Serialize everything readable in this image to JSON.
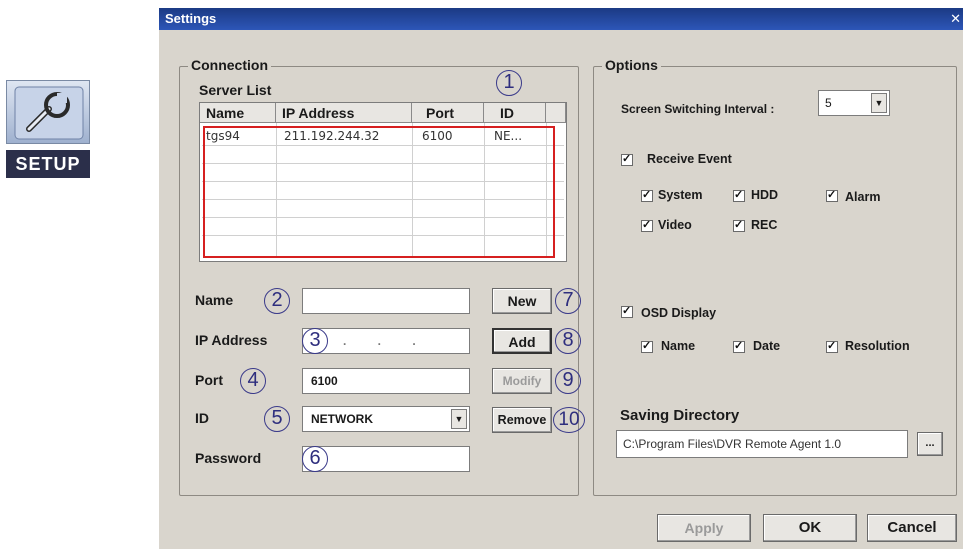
{
  "setup_tile": {
    "label": "SETUP"
  },
  "window": {
    "title": "Settings"
  },
  "connection": {
    "title": "Connection",
    "server_list_label": "Server List",
    "columns": [
      "Name",
      "IP Address",
      "Port",
      "ID"
    ],
    "rows": [
      {
        "name": "tgs94",
        "ip": "211.192.244.32",
        "port": "6100",
        "id": "NE..."
      }
    ],
    "name_label": "Name",
    "ip_label": "IP Address",
    "port_label": "Port",
    "id_label": "ID",
    "password_label": "Password",
    "name_value": "",
    "ip_value": ". . .",
    "port_value": "6100",
    "id_value": "NETWORK",
    "password_value": "",
    "new_label": "New",
    "add_label": "Add",
    "modify_label": "Modify",
    "remove_label": "Remove"
  },
  "callouts": [
    "1",
    "2",
    "3",
    "4",
    "5",
    "6",
    "7",
    "8",
    "9",
    "10"
  ],
  "options": {
    "title": "Options",
    "interval_label": "Screen Switching Interval :",
    "interval_value": "5",
    "receive_event_label": "Receive Event",
    "event_items": [
      "System",
      "HDD",
      "Alarm",
      "Video",
      "REC"
    ],
    "osd_label": "OSD Display",
    "osd_items": [
      "Name",
      "Date",
      "Resolution"
    ],
    "saving_title": "Saving Directory",
    "saving_path": "C:\\Program Files\\DVR Remote Agent 1.0",
    "browse_label": "..."
  },
  "footer": {
    "apply_label": "Apply",
    "ok_label": "OK",
    "cancel_label": "Cancel"
  },
  "colors": {
    "title_bar": "#2d56b8",
    "highlight": "#d62020",
    "callout": "#2e2e7e"
  }
}
